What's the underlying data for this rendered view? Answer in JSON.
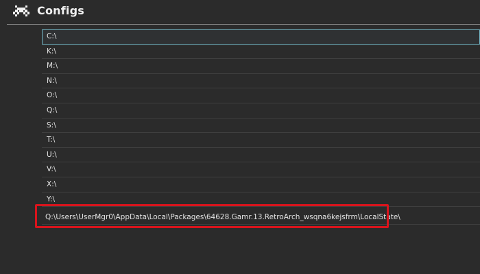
{
  "header": {
    "title": "Configs",
    "logo_icon": "retroarch-invader-icon"
  },
  "directory_list": [
    "C:\\",
    "K:\\",
    "M:\\",
    "N:\\",
    "O:\\",
    "Q:\\",
    "S:\\",
    "T:\\",
    "U:\\",
    "V:\\",
    "X:\\",
    "Y:\\"
  ],
  "selected_index": 0,
  "highlighted_path": "Q:\\Users\\UserMgr0\\AppData\\Local\\Packages\\64628.Gamr.13.RetroArch_wsqna6kejsfrm\\LocalState\\",
  "colors": {
    "background": "#2b2b2b",
    "selection_border": "#74b9c9",
    "highlight_box": "#d9141c",
    "text": "#e2e2e2"
  }
}
